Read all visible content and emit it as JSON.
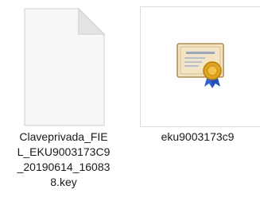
{
  "files": [
    {
      "name_lines": [
        "Claveprivada_FIE",
        "L_EKU9003173C9",
        "_20190614_16083",
        "8.key"
      ],
      "icon": "blank-document-icon"
    },
    {
      "name_lines": [
        "eku9003173c9"
      ],
      "icon": "certificate-icon"
    }
  ],
  "colors": {
    "document_page": "#f6f6f6",
    "document_fold": "#e4e4e4",
    "document_border": "#cfcfcf",
    "cert_paper": "#f3e4c4",
    "cert_frame": "#b58a4c",
    "seal_gold": "#e0a51a",
    "ribbon_blue": "#2f62d6"
  }
}
